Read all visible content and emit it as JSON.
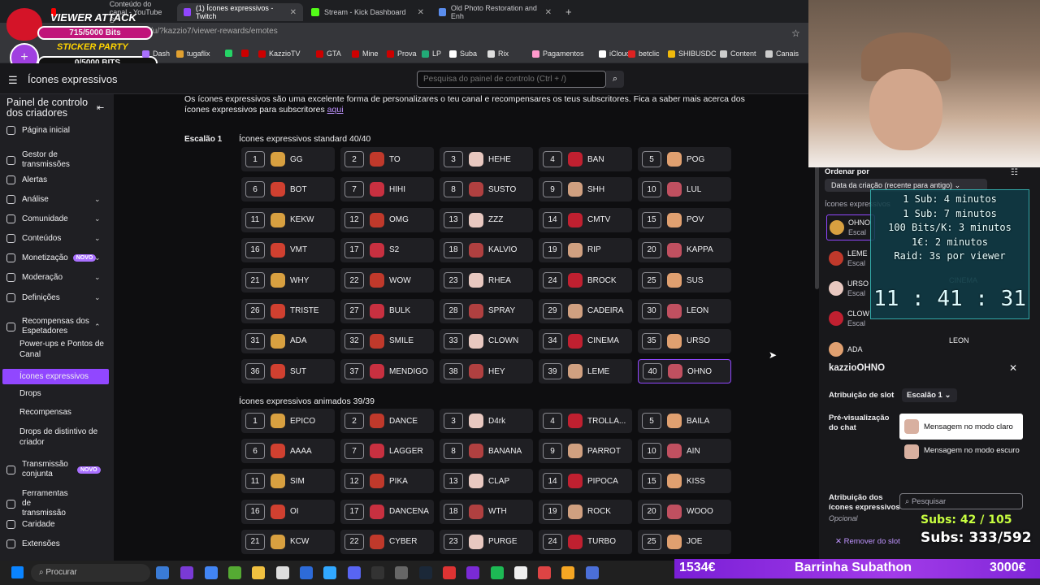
{
  "browser": {
    "tabs": [
      {
        "label": "Conteúdo do canal - YouTube S",
        "color": "#ff0000"
      },
      {
        "label": "(1) Ícones expressivos - Twitch",
        "color": "#9146ff",
        "active": true
      },
      {
        "label": "Stream - Kick Dashboard",
        "color": "#53fc18"
      },
      {
        "label": "Old Photo Restoration and Enh",
        "color": "#5a8dee"
      }
    ],
    "url": "y/u/?kazzio7/viewer-rewards/emotes",
    "bookmarks": [
      "Dash",
      "tugaflix",
      "",
      "",
      "KazzioTV",
      "GTA",
      "Mine",
      "Prova",
      "LP",
      "Suba",
      "Rix",
      "Pagamentos",
      "iCloud",
      "betclic",
      "SHIBUSDC",
      "Content",
      "Canais"
    ]
  },
  "widget": {
    "title": "VIEWER ATTACK",
    "bits_progress": "715/5000 Bits",
    "party": "STICKER PARTY",
    "bits_progress2": "0/5000 BITS"
  },
  "header": {
    "page_title": "Ícones expressivos",
    "search_placeholder": "Pesquisa do painel de controlo (Ctrl + /)"
  },
  "sidebar": {
    "title": "Painel de controlo dos criadores",
    "items": [
      {
        "label": "Página inicial"
      },
      {
        "label": "Gestor de transmissões"
      },
      {
        "label": "Alertas"
      },
      {
        "label": "Análise",
        "chev": "⌄"
      },
      {
        "label": "Comunidade",
        "chev": "⌄"
      },
      {
        "label": "Conteúdos",
        "chev": "⌄"
      },
      {
        "label": "Monetização",
        "badge": "NOVO",
        "chev": "⌄"
      },
      {
        "label": "Moderação",
        "chev": "⌄"
      },
      {
        "label": "Definições",
        "chev": "⌄"
      },
      {
        "label": "Recompensas dos Espetadores",
        "chev": "⌃"
      }
    ],
    "sub_items": [
      "Power-ups e Pontos de Canal",
      "Ícones expressivos",
      "Drops",
      "Recompensas",
      "Drops de distintivo de criador"
    ],
    "bottom_items": [
      {
        "label": "Transmissão conjunta",
        "badge": "NOVO"
      },
      {
        "label": "Ferramentas de transmissão"
      },
      {
        "label": "Caridade"
      },
      {
        "label": "Extensões"
      }
    ]
  },
  "main": {
    "intro": "Os ícones expressivos são uma excelente forma de personalizares o teu canal e recompensares os teus subscritores. Fica a saber mais acerca dos ícones expressivos para subscritores",
    "intro_link": "aqui",
    "tier_label": "Escalão 1",
    "standard_title": "Ícones expressivos standard 40/40",
    "animated_title": "Ícones expressivos animados 39/39",
    "standard": [
      "GG",
      "TO",
      "HEHE",
      "BAN",
      "POG",
      "BOT",
      "HIHI",
      "SUSTO",
      "SHH",
      "LUL",
      "KEKW",
      "OMG",
      "ZZZ",
      "CMTV",
      "POV",
      "VMT",
      "S2",
      "KALVIO",
      "RIP",
      "KAPPA",
      "WHY",
      "WOW",
      "RHEA",
      "BROCK",
      "SUS",
      "TRISTE",
      "BULK",
      "SPRAY",
      "CADEIRA",
      "LEON",
      "ADA",
      "SMILE",
      "CLOWN",
      "CINEMA",
      "URSO",
      "SUT",
      "MENDIGO",
      "HEY",
      "LEME",
      "OHNO"
    ],
    "animated": [
      "EPICO",
      "DANCE",
      "D4rk",
      "TROLLA...",
      "BAILA",
      "AAAA",
      "LAGGER",
      "BANANA",
      "PARROT",
      "AIN",
      "SIM",
      "PIKA",
      "CLAP",
      "PIPOCA",
      "KISS",
      "OI",
      "DANCENA",
      "WTH",
      "ROCK",
      "WOOO",
      "KCW",
      "CYBER",
      "PURGE",
      "TURBO",
      "JOE"
    ],
    "emote_colors": [
      "#d8a040",
      "#c0392b",
      "#e8c8c0",
      "#c02030",
      "#e0a070",
      "#d04030",
      "#c83040",
      "#b04040",
      "#d0a080",
      "#c05060"
    ]
  },
  "panel": {
    "sort_label": "Ordenar por",
    "sort_value": "Data da criação (recente para antigo)",
    "list_header": "Ícones expressivos",
    "list": [
      {
        "name": "OHNO",
        "sub": "Escal"
      },
      {
        "name": "LEME",
        "sub": "Escal"
      },
      {
        "name": "URSO",
        "sub": "Escal"
      },
      {
        "name": "CLOW",
        "sub": "Escal"
      },
      {
        "name": "ADA",
        "sub": ""
      }
    ],
    "list_right": [
      "CINEMA",
      "LEON"
    ],
    "detail_title": "kazzioOHNO",
    "slot_label": "Atribuição de slot",
    "slot_value": "Escalão 1",
    "preview_label": "Pré-visualização do chat",
    "light_msg": "Mensagem no modo claro",
    "dark_msg": "Mensagem no modo escuro",
    "assign_label": "Atribuição dos ícones expressivos",
    "optional": "Opcional",
    "assign_search": "Pesquisar",
    "remove": "Remover do slot"
  },
  "overlay": {
    "lines": [
      "1 Sub: 4 minutos",
      "1 Sub: 7 minutos",
      "100 Bits/K: 3 minutos",
      "1€: 2 minutos",
      "Raid: 3s por viewer"
    ],
    "timer": "11 : 41 : 31",
    "subs1": "Subs: 42 / 105",
    "subs2": "Subs: 333/592"
  },
  "subathon": {
    "left": "1534€",
    "title": "Barrinha Subathon",
    "right": "3000€"
  },
  "taskbar": {
    "search": "Procurar"
  }
}
